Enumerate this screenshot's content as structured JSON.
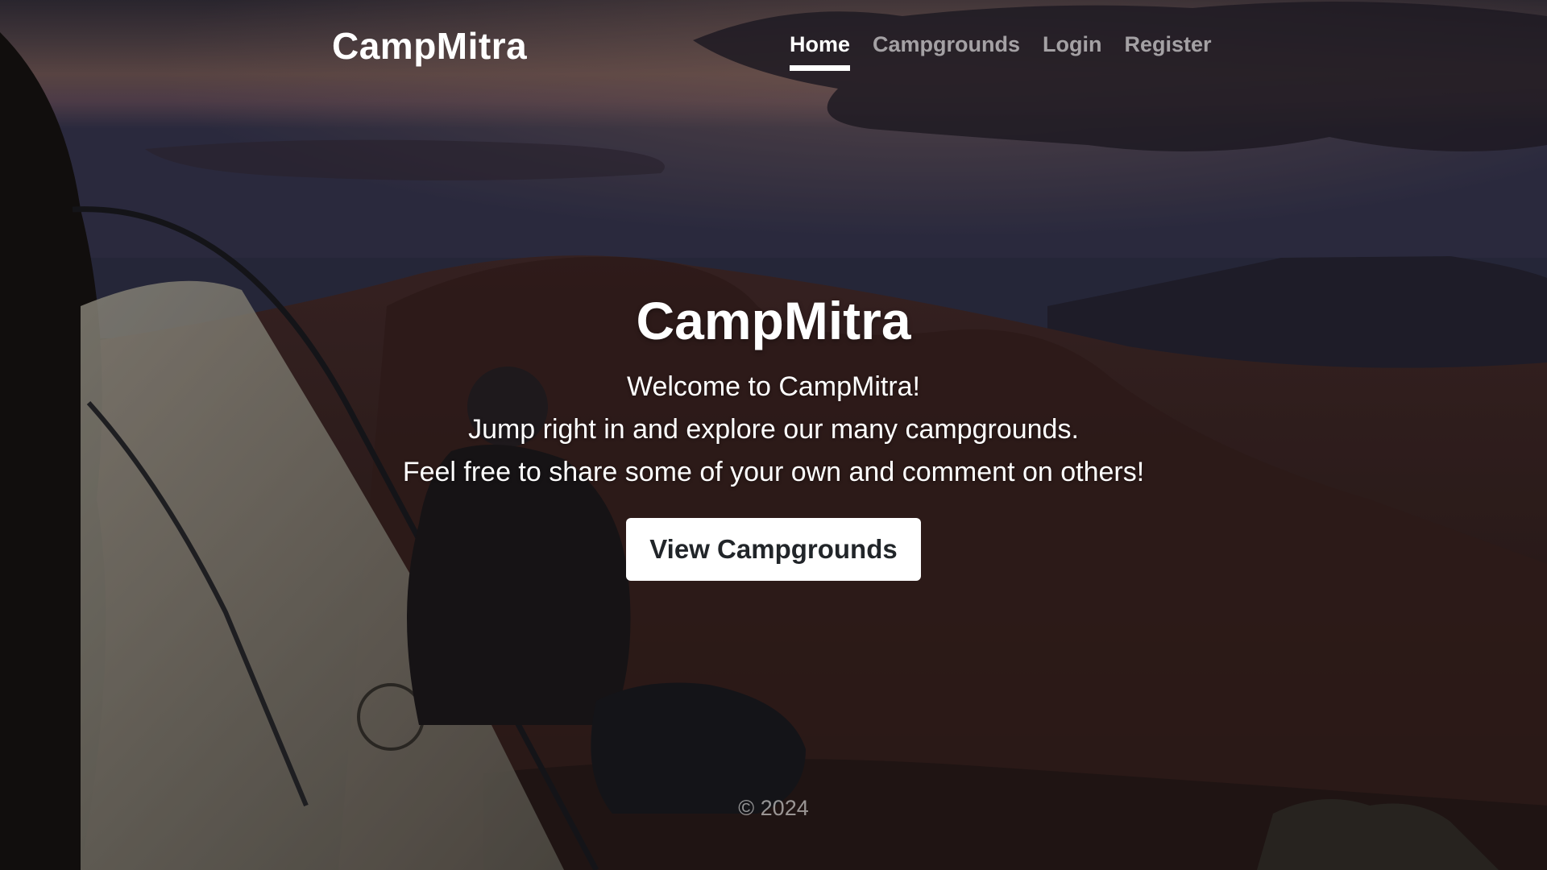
{
  "header": {
    "brand": "CampMitra",
    "nav": {
      "home": "Home",
      "campgrounds": "Campgrounds",
      "login": "Login",
      "register": "Register"
    },
    "active_item": "Home"
  },
  "hero": {
    "title": "CampMitra",
    "line1": "Welcome to CampMitra!",
    "line2": "Jump right in and explore our many campgrounds.",
    "line3": "Feel free to share some of your own and comment on others!",
    "cta_label": "View Campgrounds"
  },
  "footer": {
    "copyright": "© 2024"
  },
  "colors": {
    "text": "#ffffff",
    "nav_inactive": "rgba(255,255,255,0.58)",
    "button_bg": "#ffffff",
    "button_text": "#212529"
  },
  "background": {
    "icons": [
      "landscape-photo"
    ]
  }
}
